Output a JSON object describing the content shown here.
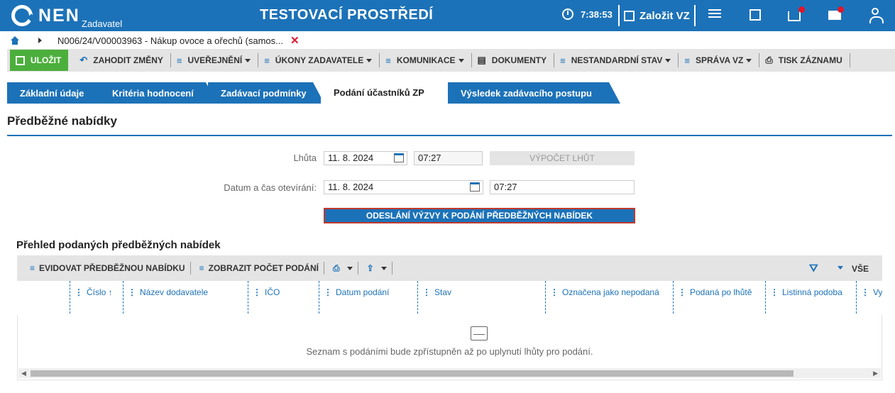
{
  "header": {
    "logo": "NEN",
    "logo_sub": "Zadavatel",
    "env_title": "TESTOVACÍ PROSTŘEDÍ",
    "time": "7:38:53",
    "create_label": "Založit VZ",
    "accent_color": "#1c72b8"
  },
  "breadcrumb": {
    "item": "N006/24/V00003963 - Nákup ovoce a ořechů (samos..."
  },
  "toolbar": {
    "save": "ULOŽIT",
    "discard": "ZAHODIT ZMĚNY",
    "publish": "UVEŘEJNĚNÍ",
    "actions": "ÚKONY ZADAVATELE",
    "communication": "KOMUNIKACE",
    "documents": "DOKUMENTY",
    "nonstandard": "NESTANDARDNÍ STAV",
    "admin": "SPRÁVA VZ",
    "print": "TISK ZÁZNAMU"
  },
  "tabs": [
    {
      "label": "Základní údaje"
    },
    {
      "label": "Kritéria hodnocení"
    },
    {
      "label": "Zadávací podmínky"
    },
    {
      "label": "Podání účastníků ZP"
    },
    {
      "label": "Výsledek zadávacího postupu"
    }
  ],
  "section": {
    "title": "Předběžné nabídky",
    "deadline_label": "Lhůta",
    "deadline_date": "11. 8. 2024",
    "deadline_time": "07:27",
    "calc_button": "VÝPOČET LHŮT",
    "opening_label": "Datum a čas otevírání:",
    "opening_date": "11. 8. 2024",
    "opening_time": "07:27",
    "send_button": "ODESLÁNÍ VÝZVY K PODÁNÍ PŘEDBĚŽNÝCH NABÍDEK"
  },
  "overview": {
    "title": "Přehled podaných předběžných nabídek",
    "register_button": "EVIDOVAT PŘEDBĚŽNOU NABÍDKU",
    "count_button": "ZOBRAZIT POČET PODÁNÍ",
    "filter_all": "VŠE",
    "columns": [
      "Číslo ↑",
      "Název dodavatele",
      "IČO",
      "Datum podání",
      "Stav",
      "Označena jako nepodaná",
      "Podaná po lhůtě",
      "Listinná podoba",
      "Vy sl"
    ],
    "empty_text": "Seznam s podáními bude zpřístupněn až po uplynutí lhůty pro podání."
  }
}
